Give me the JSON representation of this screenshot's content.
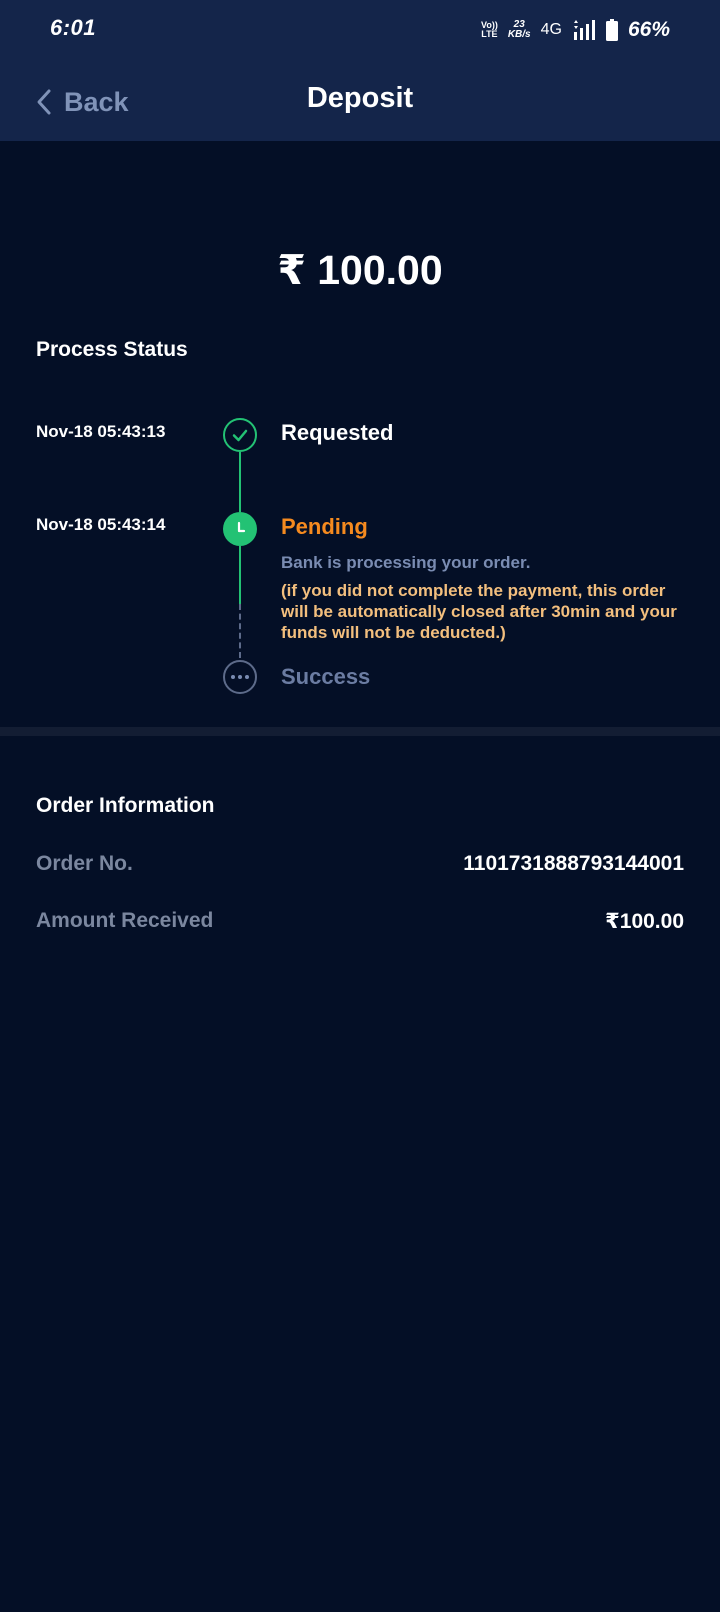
{
  "status_bar": {
    "time": "6:01",
    "volte_top": "Vo))",
    "volte_bottom": "LTE",
    "speed_top": "23",
    "speed_bottom": "KB/s",
    "network": "4G",
    "battery": "66%"
  },
  "nav": {
    "back_label": "Back",
    "title": "Deposit"
  },
  "amount": "₹ 100.00",
  "process": {
    "title": "Process Status",
    "steps": [
      {
        "time": "Nov-18 05:43:13",
        "label": "Requested",
        "state": "done"
      },
      {
        "time": "Nov-18 05:43:14",
        "label": "Pending",
        "state": "pending",
        "description": "Bank is processing your order.",
        "warning": "(if you did not complete the payment, this order will be automatically closed after 30min and your funds will not be deducted.)"
      },
      {
        "time": "",
        "label": "Success",
        "state": "future"
      }
    ]
  },
  "order": {
    "title": "Order Information",
    "rows": [
      {
        "label": "Order No.",
        "value": "1101731888793144001"
      },
      {
        "label": "Amount Received",
        "value": "₹100.00"
      }
    ]
  },
  "colors": {
    "background": "#040f26",
    "header": "#14254a",
    "accent_green": "#23c274",
    "pending_orange": "#f58a1f",
    "warning_text": "#f3bf7e",
    "muted": "#7a8cb2"
  }
}
